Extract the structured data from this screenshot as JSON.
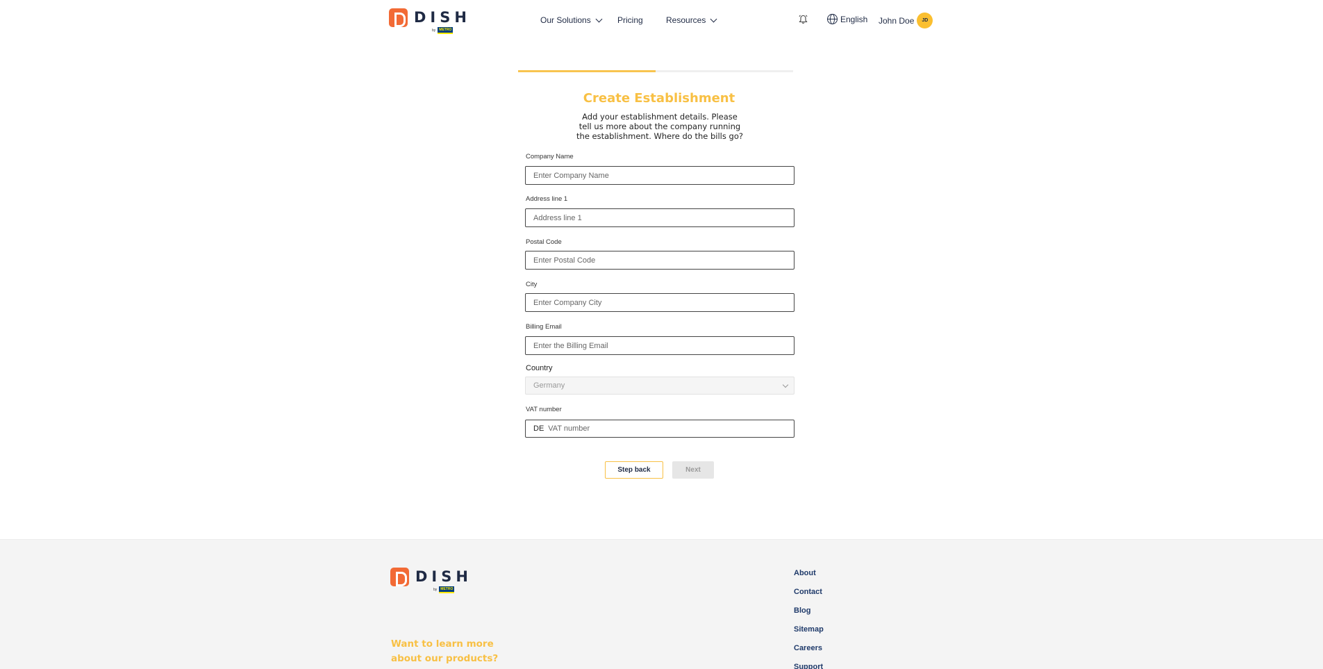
{
  "brand": {
    "name": "DISH",
    "by": "by",
    "metro": "METRO"
  },
  "nav": {
    "solutions": "Our Solutions",
    "pricing": "Pricing",
    "resources": "Resources"
  },
  "header": {
    "language": "English",
    "user_name": "John Doe",
    "user_initials": "JD"
  },
  "progress": {
    "fraction": 0.5
  },
  "form": {
    "title": "Create Establishment",
    "subtitle": "Add your establishment details. Please tell us more about the company running the establishment. Where do the bills go?",
    "company_name": {
      "label": "Company Name",
      "placeholder": "Enter Company Name"
    },
    "address1": {
      "label": "Address line 1",
      "placeholder": "Address line 1"
    },
    "postal": {
      "label": "Postal Code",
      "placeholder": "Enter Postal Code"
    },
    "city": {
      "label": "City",
      "placeholder": "Enter Company City"
    },
    "billing_email": {
      "label": "Billing Email",
      "placeholder": "Enter the Billing Email"
    },
    "country": {
      "label": "Country",
      "value": "Germany"
    },
    "vat": {
      "label": "VAT number",
      "prefix": "DE",
      "placeholder": "VAT number"
    },
    "back_label": "Step back",
    "next_label": "Next"
  },
  "footer": {
    "cta": "Want to learn more about our products?",
    "links": [
      "About",
      "Contact",
      "Blog",
      "Sitemap",
      "Careers",
      "Support"
    ]
  },
  "colors": {
    "accent": "#f8c044",
    "logo": "#f26a35",
    "navy": "#1f2a44"
  }
}
